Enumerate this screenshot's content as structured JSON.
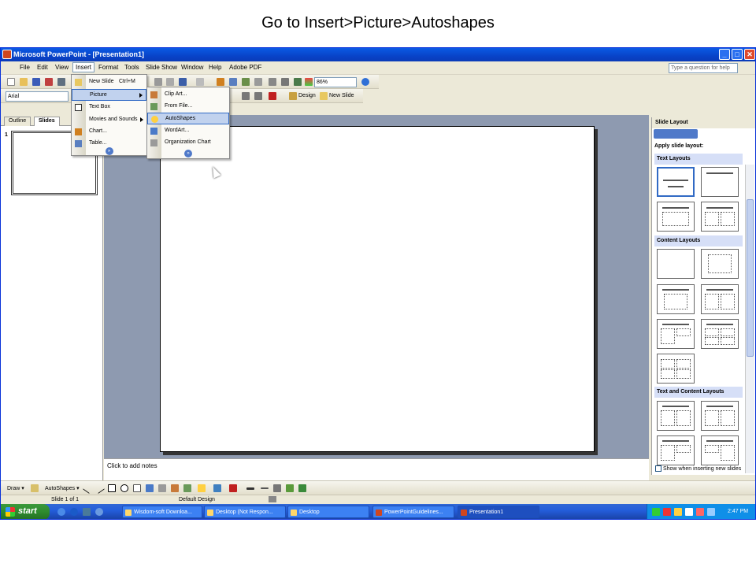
{
  "caption": "Go to Insert>Picture>Autoshapes",
  "window": {
    "title": "Microsoft PowerPoint - [Presentation1]",
    "buttons": {
      "minimize": "_",
      "maximize": "□",
      "close": "✕"
    }
  },
  "menubar": {
    "items": [
      "File",
      "Edit",
      "View",
      "Insert",
      "Format",
      "Tools",
      "Slide Show",
      "Window",
      "Help",
      "Adobe PDF"
    ],
    "help_placeholder": "Type a question for help"
  },
  "toolbar": {
    "zoom": "86%",
    "font": "Arial",
    "design_label": "Design",
    "new_slide_label": "New Slide"
  },
  "insert_menu": {
    "items": [
      {
        "label": "New Slide",
        "shortcut": "Ctrl+M"
      },
      {
        "label": "Picture",
        "submenu": true
      },
      {
        "label": "Text Box"
      },
      {
        "label": "Movies and Sounds",
        "submenu": true
      },
      {
        "label": "Chart..."
      },
      {
        "label": "Table..."
      }
    ],
    "more": "»"
  },
  "picture_menu": {
    "items": [
      {
        "label": "Clip Art..."
      },
      {
        "label": "From File..."
      },
      {
        "label": "AutoShapes"
      },
      {
        "label": "WordArt..."
      },
      {
        "label": "Organization Chart"
      }
    ],
    "more": "»"
  },
  "left_pane": {
    "tabs": [
      "Outline",
      "Slides"
    ],
    "slide_number": "1"
  },
  "notes": {
    "text": "Click to add notes"
  },
  "task_pane": {
    "title": "Slide Layout",
    "subtitle": "Apply slide layout:",
    "sections": [
      "Text Layouts",
      "Content Layouts",
      "Text and Content Layouts"
    ],
    "footer": "Show when inserting new slides"
  },
  "drawbar": {
    "draw_label": "Draw ▾",
    "autoshapes_label": "AutoShapes ▾"
  },
  "statusbar": {
    "slide": "Slide 1 of 1",
    "design": "Default Design"
  },
  "taskbar": {
    "start": "start",
    "tasks": [
      "Wisdom-soft Downloa...",
      "Desktop (Not Respon...",
      "Desktop",
      "PowerPointGuidelines...",
      "Presentation1"
    ],
    "clock": "2:47 PM"
  },
  "colors": {
    "titlebar": "#0a5ae4",
    "menu_highlight": "#c1d2ee",
    "slide_bg": "#8e9ab0",
    "taskbar": "#245edb",
    "start": "#2e8b2e"
  }
}
